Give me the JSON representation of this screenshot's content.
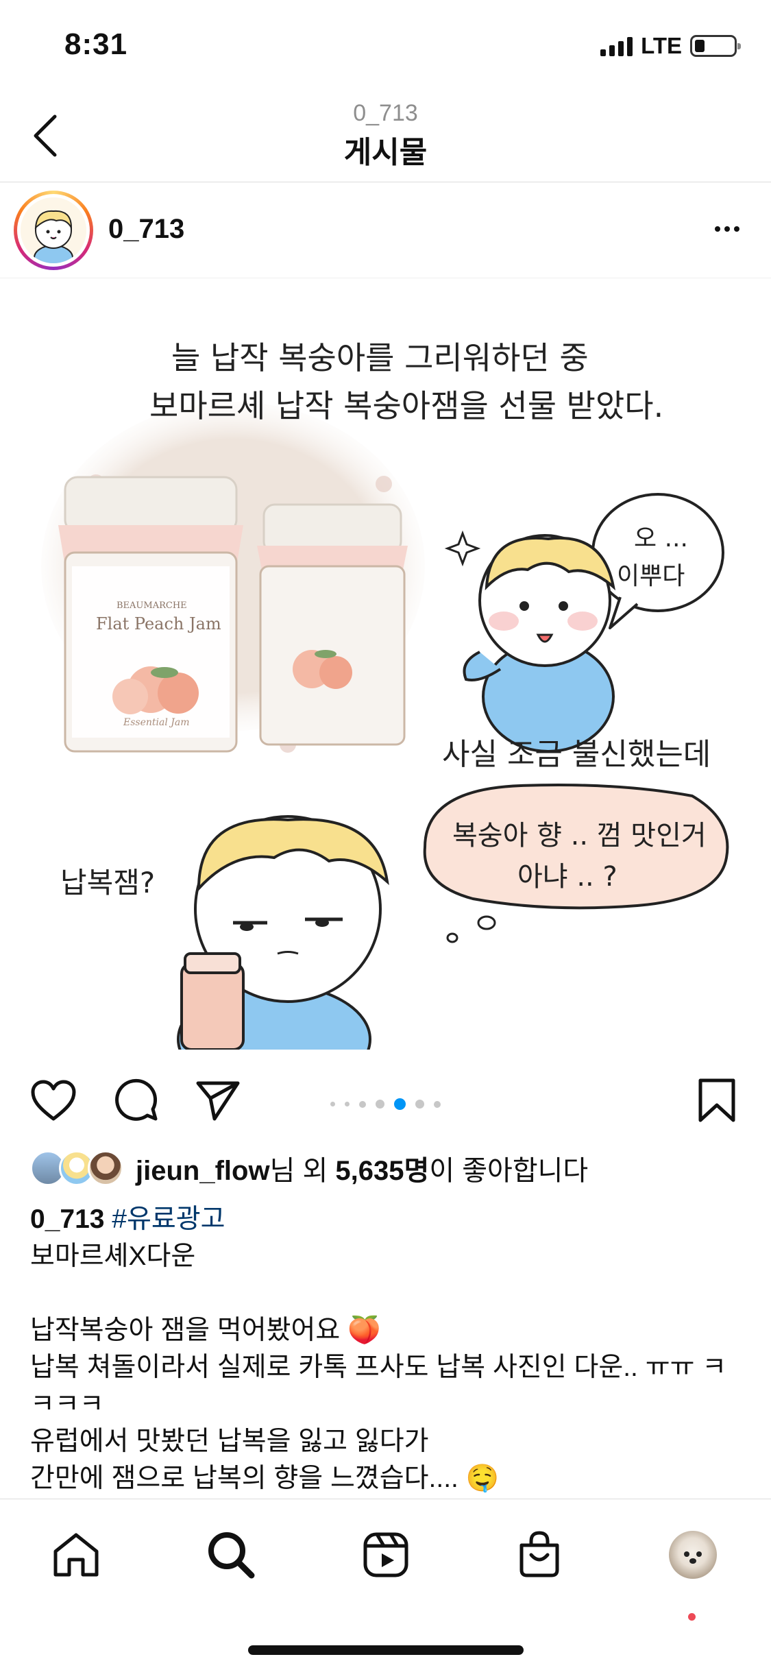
{
  "status_bar": {
    "time": "8:31",
    "network": "LTE",
    "battery_level": 0.2
  },
  "header": {
    "subtitle": "0_713",
    "title": "게시물"
  },
  "owner": {
    "username": "0_713"
  },
  "post_image": {
    "top_text_line1": "늘 납작 복숭아를  그리워하던 중",
    "top_text_line2": "보마르셰 납작 복숭아잼을 선물 받았다.",
    "jar_brand": "BEAUMARCHE",
    "jar_label": "Flat Peach Jam",
    "jar_sub": "Essential Jam",
    "speech_bubble_line1": "오 ...",
    "speech_bubble_line2": "이뿌다",
    "middle_text": "사실 조금 불신했는데",
    "left_question": "납복잼?",
    "thought_bubble_line1": "복숭아 향 .. 껌 맛인거",
    "thought_bubble_line2": "아냐 .. ?"
  },
  "carousel": {
    "total_dots": 7,
    "active_index": 4
  },
  "likes": {
    "username": "jieun_flow",
    "mid_text": "님 외 ",
    "count": "5,635명",
    "tail_text": "이 좋아합니다"
  },
  "caption": {
    "username": "0_713",
    "hashtag": "#유료광고",
    "line1": "보마르셰X다운",
    "line2": "납작복숭아 잼을 먹어봤어요 🍑",
    "line3": "납복 쳐돌이라서 실제로 카톡 프사도 납복 사진인 다운.. ㅠㅠ ㅋ",
    "line4": "ㅋㅋㅋ",
    "line5": "유럽에서 맛봤던 납복을 잃고 잃다가",
    "line6": "간만에 잼으로 납복의 향을 느꼈습다.... 🤤"
  },
  "colors": {
    "accent_blue": "#0095f6",
    "hashtag": "#00376b",
    "notification_dot": "#ed4956",
    "comic_blue": "#8ec8f0",
    "comic_hair": "#f8e08e",
    "jar_peach": "#f4b9a5"
  },
  "icons": {
    "back": "chevron-left-icon",
    "more": "more-horizontal-icon",
    "like": "heart-icon",
    "comment": "comment-icon",
    "share": "send-icon",
    "save": "bookmark-icon",
    "home": "home-icon",
    "search": "search-icon",
    "reels": "reels-icon",
    "shop": "shop-bag-icon"
  }
}
